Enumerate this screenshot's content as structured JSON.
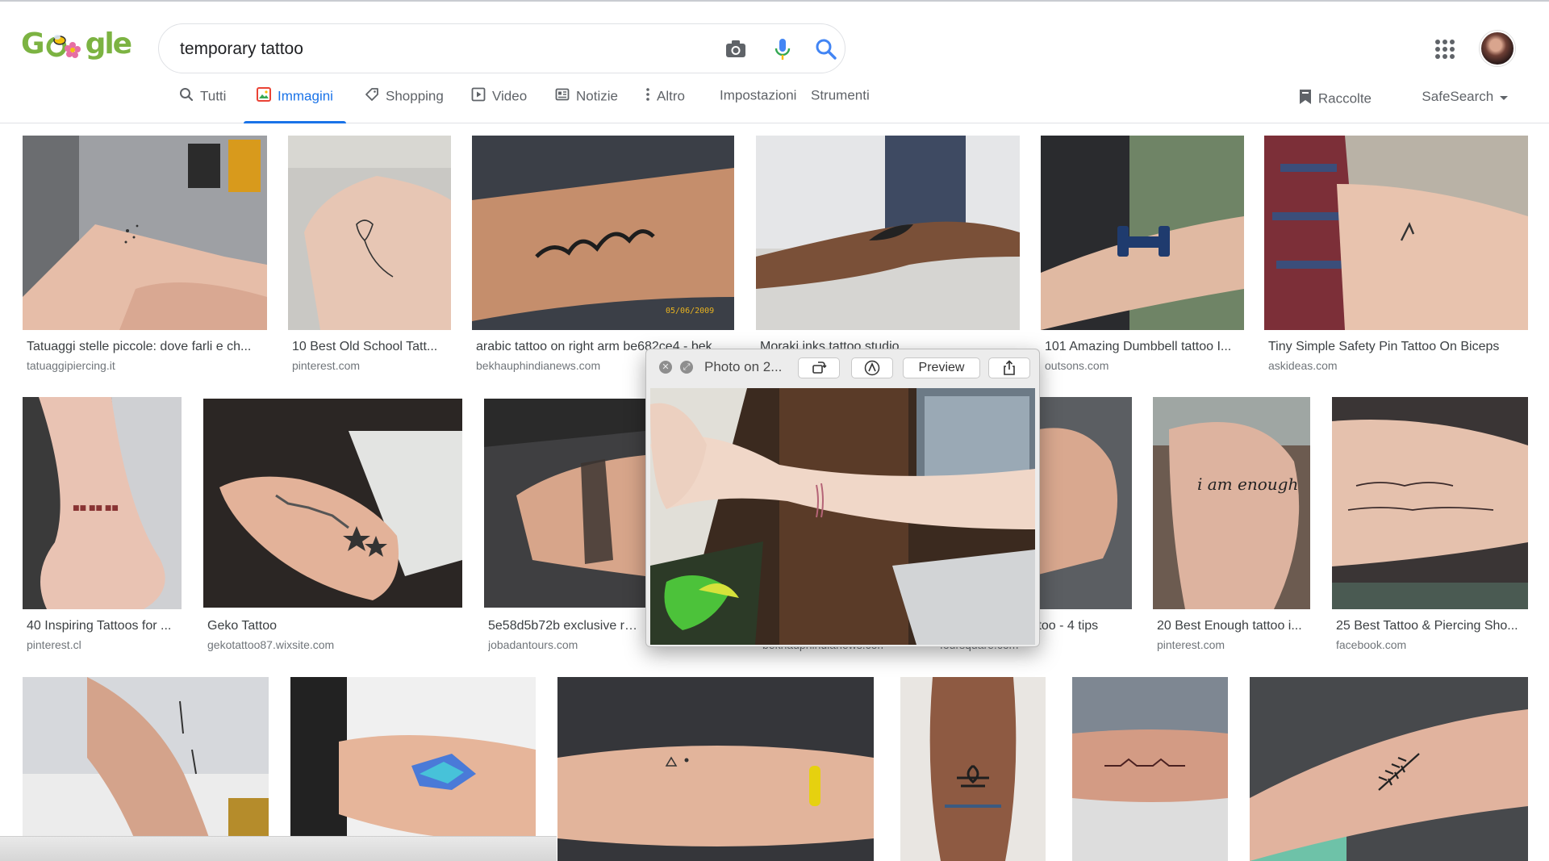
{
  "search": {
    "query": "temporary tattoo",
    "camera_icon": "camera-icon",
    "mic_icon": "microphone-icon",
    "search_icon": "search-icon"
  },
  "tabs": [
    {
      "label": "Tutti",
      "icon": "search-icon"
    },
    {
      "label": "Immagini",
      "icon": "image-icon",
      "active": true
    },
    {
      "label": "Shopping",
      "icon": "tag-icon"
    },
    {
      "label": "Video",
      "icon": "play-icon"
    },
    {
      "label": "Notizie",
      "icon": "news-icon"
    },
    {
      "label": "Altro",
      "icon": "more-vert-icon"
    },
    {
      "label": "Impostazioni"
    },
    {
      "label": "Strumenti"
    }
  ],
  "toolbar_right": {
    "collections": "Raccolte",
    "safesearch": "SafeSearch"
  },
  "results": [
    {
      "title": "Tatuaggi stelle piccole: dove farli e ch...",
      "source": "tatuaggipiercing.it"
    },
    {
      "title": "10 Best Old School Tatt...",
      "source": "pinterest.com"
    },
    {
      "title": "arabic tattoo on right arm be682ce4 - bek...",
      "source": "bekhauphindianews.com"
    },
    {
      "title": "Moraki inks tattoo studio",
      "source": ""
    },
    {
      "title": "101 Amazing Dumbbell tattoo I...",
      "source": "outsons.com"
    },
    {
      "title": "Tiny Simple Safety Pin Tattoo On Biceps",
      "source": "askideas.com"
    },
    {
      "title": "40 Inspiring Tattoos for ...",
      "source": "pinterest.cl"
    },
    {
      "title": "Geko Tattoo",
      "source": "gekotattoo87.wixsite.com"
    },
    {
      "title": "5e58d5b72b exclusive range",
      "source": "jobadantours.com"
    },
    {
      "title": "",
      "source": "bekhauphindianews.com"
    },
    {
      "title": "ttoo - 4 tips",
      "source": "foursquare.com"
    },
    {
      "title": "20 Best Enough tattoo i...",
      "source": "pinterest.com"
    },
    {
      "title": "25 Best Tattoo & Piercing Sho...",
      "source": "facebook.com"
    }
  ],
  "preview": {
    "title": "Photo on 2...",
    "preview_label": "Preview"
  },
  "colors": {
    "accent": "#1a73e8",
    "text_secondary": "#5f6368"
  }
}
